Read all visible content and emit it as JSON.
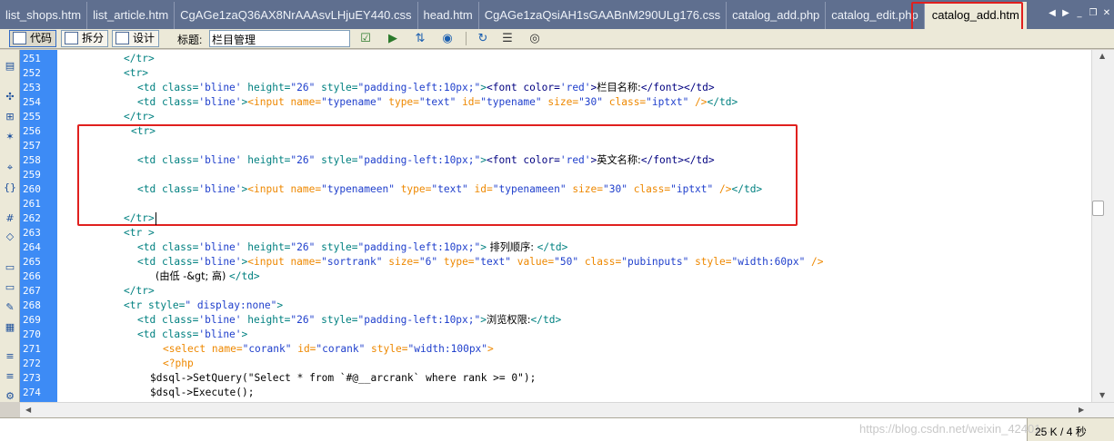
{
  "tabs": [
    {
      "label": "list_shops.htm",
      "active": false
    },
    {
      "label": "list_article.htm",
      "active": false
    },
    {
      "label": "CgAGe1zaQ36AX8NrAAAsvLHjuEY440.css",
      "active": false
    },
    {
      "label": "head.htm",
      "active": false
    },
    {
      "label": "CgAGe1zaQsiAH1sGAABnM290ULg176.css",
      "active": false
    },
    {
      "label": "catalog_add.php",
      "active": false
    },
    {
      "label": "catalog_edit.php",
      "active": false
    },
    {
      "label": "catalog_add.htm",
      "active": true
    }
  ],
  "toolbar": {
    "code_label": "代码",
    "split_label": "拆分",
    "design_label": "设计",
    "title_label": "标题:",
    "title_value": "栏目管理"
  },
  "gutter": {
    "line_numbers": [
      "251",
      "252",
      "253",
      "254",
      "255",
      "256",
      "257",
      "258",
      "259",
      "260",
      "261",
      "262",
      "263",
      "264",
      "265",
      "266",
      "267",
      "268",
      "269",
      "270",
      "271",
      "272",
      "273",
      "274"
    ]
  },
  "code": {
    "l251": "</tr>",
    "l252": "<tr>",
    "l253_open": "<td ",
    "l253_class": "class=",
    "l253_classv": "'bline'",
    "l253_h": " height=",
    "l253_hv": "\"26\"",
    "l253_s": " style=",
    "l253_sv": "\"padding-left:10px;\"",
    "l253_gt": ">",
    "l253_font": "<font ",
    "l253_color": "color=",
    "l253_colorv": "'red'",
    "l253_fgt": ">",
    "l253_text": "栏目名称:",
    "l253_close": "</font></td>",
    "l254_open": "<td ",
    "l254_class": "class=",
    "l254_classv": "'bline'",
    "l254_gt": ">",
    "l254_input": "<input ",
    "l254_name": "name=",
    "l254_namev": "\"typename\"",
    "l254_type": " type=",
    "l254_typev": "\"text\"",
    "l254_id": " id=",
    "l254_idv": "\"typename\"",
    "l254_size": " size=",
    "l254_sizev": "\"30\"",
    "l254_cls": " class=",
    "l254_clsv": "\"iptxt\"",
    "l254_end": " />",
    "l254_close": "</td>",
    "l255": "</tr>",
    "l256": "<tr>",
    "l258_text": "英文名称:",
    "l260_namev": "\"typenameen\"",
    "l260_idv": "\"typenameen\"",
    "l262": "</tr",
    "l262_gt": ">",
    "l263": "<tr >",
    "l263_text": " 排列顺序: ",
    "l263_close": "</td>",
    "l264_namev": "\"sortrank\"",
    "l264_size": " size=",
    "l264_sizev": "\"6\"",
    "l264_value": " value=",
    "l264_valuev": "\"50\"",
    "l264_cls": " class=",
    "l264_clsv": "\"pubinputs\"",
    "l264_style": " style=",
    "l264_stylev": "\"width:60px\"",
    "l264_end": " />",
    "l265_text": "(由低 -&gt; 高) ",
    "l265_close": "</td>",
    "l266": "</tr>",
    "l267_open": "<tr ",
    "l267_style": "style=",
    "l267_stylev": "\" display:none\"",
    "l267_gt": ">",
    "l268_text": "浏览权限:",
    "l268_close": "</td>",
    "l269_close": ">",
    "l270_select": "<select ",
    "l270_name": "name=",
    "l270_namev": "\"corank\"",
    "l270_id": " id=",
    "l270_idv": "\"corank\"",
    "l270_style": " style=",
    "l270_stylev": "\"width:100px\"",
    "l270_gt": ">",
    "l271": "<?php",
    "l272": "$dsql->SetQuery(\"Select * from `#@__arcrank` where rank >= 0\");",
    "l273": "$dsql->Execute();"
  },
  "status": {
    "size_time": "25 K / 4 秒",
    "watermark": "https://blog.csdn.net/weixin_42401..."
  },
  "colors": {
    "tabbar": "#5f6f8f",
    "gutter": "#3d8bf5",
    "highlight": "#e0201e",
    "tag": "#008080",
    "input_tag": "#ee8800",
    "attr_value": "#1f3fcc"
  }
}
